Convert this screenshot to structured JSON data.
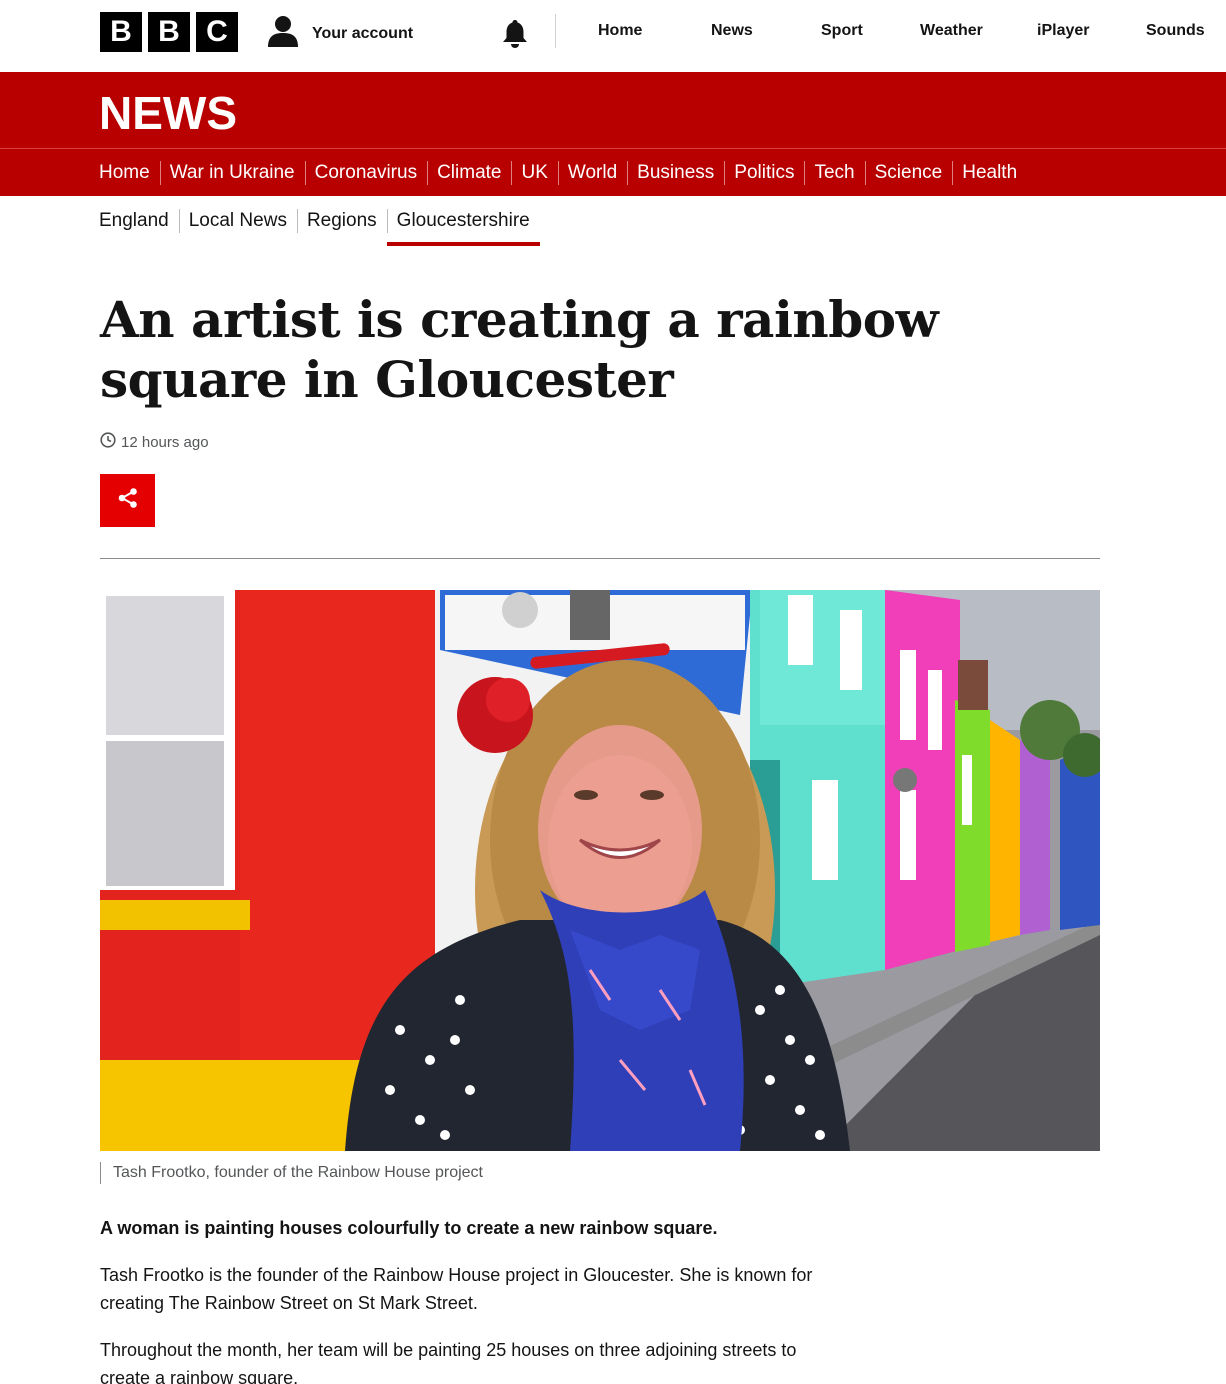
{
  "bbc_logo": [
    "B",
    "B",
    "C"
  ],
  "account": {
    "label": "Your account",
    "icon": "user-icon"
  },
  "notifications_icon": "bell-icon",
  "top_nav": [
    "Home",
    "News",
    "Sport",
    "Weather",
    "iPlayer",
    "Sounds"
  ],
  "section_brand": "NEWS",
  "news_nav": [
    "Home",
    "War in Ukraine",
    "Coronavirus",
    "Climate",
    "UK",
    "World",
    "Business",
    "Politics",
    "Tech",
    "Science",
    "Health"
  ],
  "sub_nav": [
    "England",
    "Local News",
    "Regions",
    "Gloucestershire"
  ],
  "sub_nav_active": "Gloucestershire",
  "article": {
    "headline": "An artist is creating a rainbow square in Gloucester",
    "timestamp": "12 hours ago",
    "share_icon": "share-icon",
    "image_caption": "Tash Frootko, founder of the Rainbow House project",
    "paragraphs": [
      "A woman is painting houses colourfully to create a new rainbow square.",
      "Tash Frootko is the founder of the Rainbow House project in Gloucester. She is known for creating The Rainbow Street on St Mark Street.",
      "Throughout the month, her team will be painting 25 houses on three adjoining streets to create a rainbow square."
    ]
  },
  "colors": {
    "news_red": "#b80000",
    "share_red": "#e40000",
    "text": "#141414",
    "meta": "#545658"
  }
}
